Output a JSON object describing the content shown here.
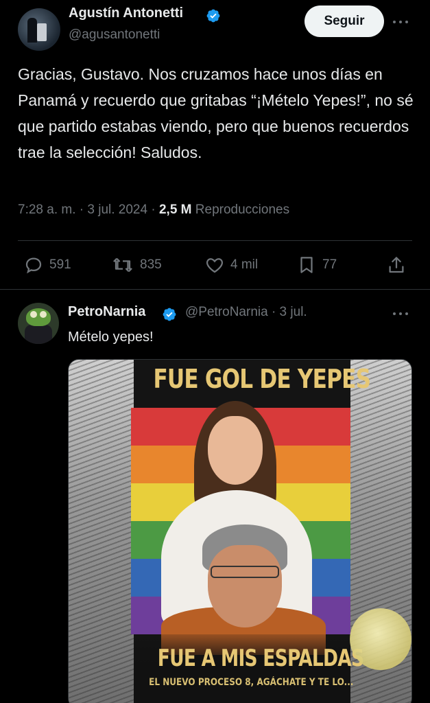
{
  "main_tweet": {
    "display_name": "Agustín Antonetti",
    "handle": "@agusantonetti",
    "follow_label": "Seguir",
    "text": "Gracias, Gustavo. Nos cruzamos hace unos días en Panamá y recuerdo que gritabas “¡Mételo Yepes!”, no sé que partido estabas viendo, pero que buenos recuerdos trae la selección! Saludos.",
    "time": "7:28 a. m.",
    "separator": "·",
    "date": "3 jul. 2024",
    "views_count": "2,5 M",
    "views_label": "Reproducciones",
    "actions": {
      "replies": "591",
      "retweets": "835",
      "likes": "4 mil",
      "bookmarks": "77"
    }
  },
  "reply_tweet": {
    "display_name": "PetroNarnia",
    "handle_date": "@PetroNarnia · 3 jul.",
    "text": "Mételo yepes!",
    "media": {
      "poster_title": "FUE GOL DE YEPES",
      "poster_subtitle": "FUE A MIS ESPALDAS",
      "poster_caption": "EL NUEVO PROCESO 8, AGÁCHATE Y TE LO..."
    }
  },
  "colors": {
    "background": "#000000",
    "text_primary": "#e7e9ea",
    "text_secondary": "#71767b",
    "verified_blue": "#1d9bf0",
    "divider": "#2f3336",
    "follow_button_bg": "#eff3f4"
  },
  "icons": [
    "verified-badge-icon",
    "more-options-icon",
    "reply-icon",
    "retweet-icon",
    "like-icon",
    "bookmark-icon",
    "share-icon"
  ]
}
